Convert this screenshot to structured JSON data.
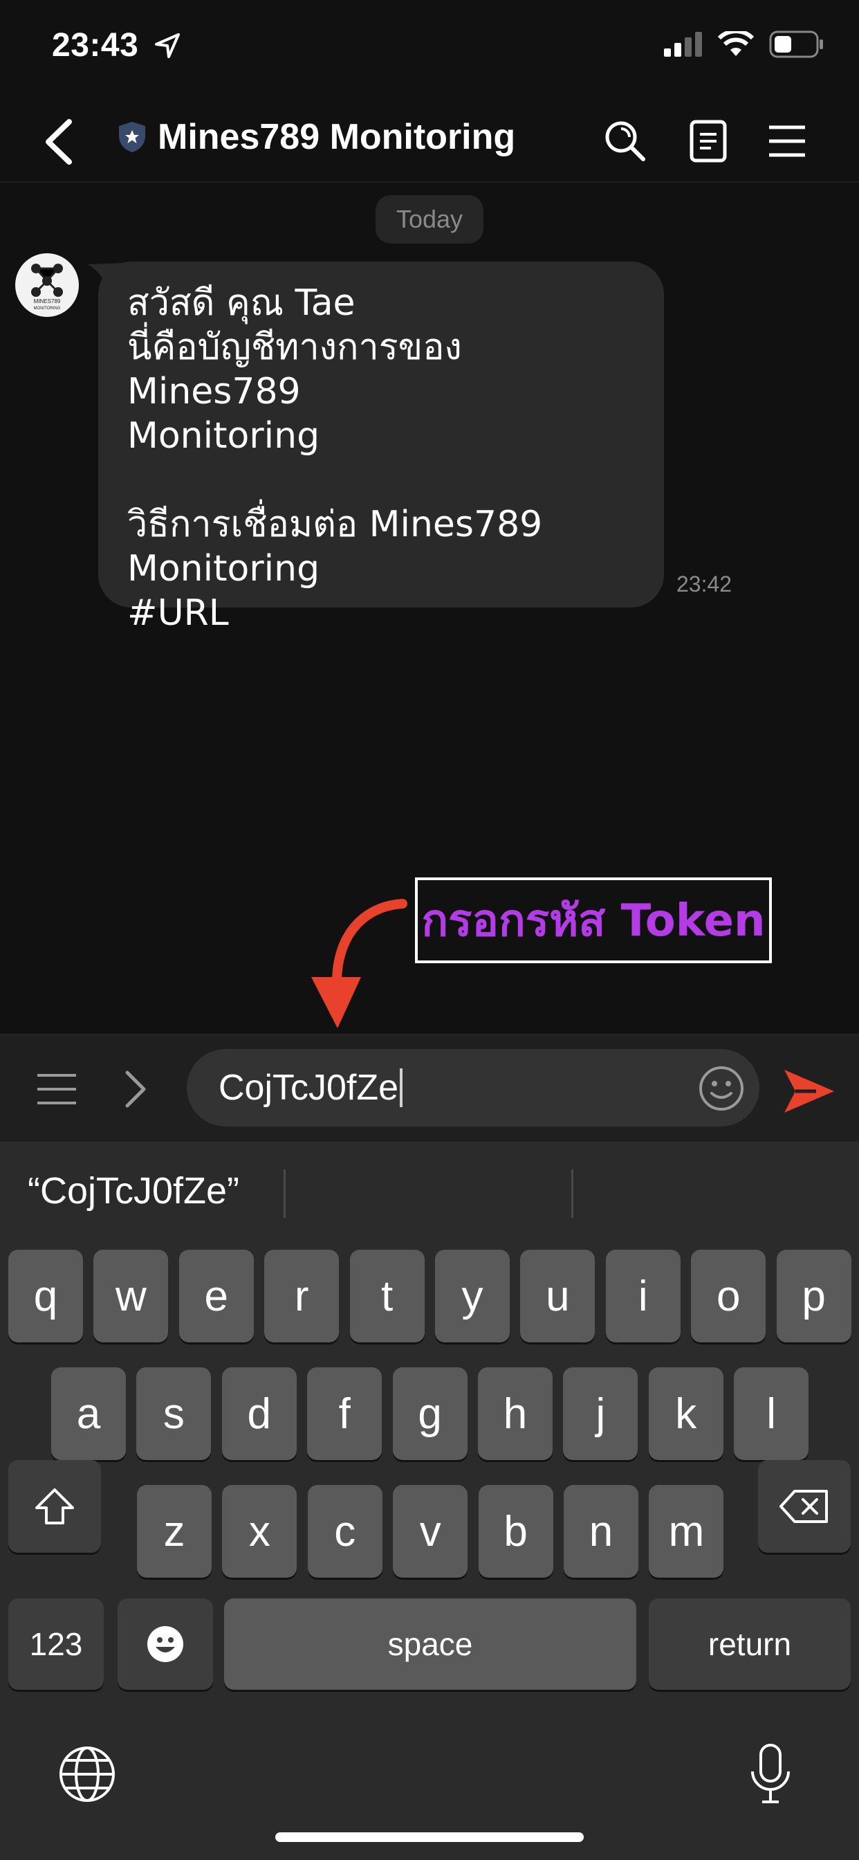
{
  "status": {
    "time": "23:43"
  },
  "header": {
    "title": "Mines789 Monitoring"
  },
  "chat": {
    "date_label": "Today",
    "avatar_text": "MINES789 MONITORING",
    "message": "สวัสดี คุณ Tae\nนี่คือบัญชีทางการของ Mines789\nMonitoring\n\nวิธีการเชื่อมต่อ Mines789\nMonitoring\n#URL",
    "message_time": "23:42"
  },
  "annotation": {
    "text": "กรอกรหัส Token",
    "color": "#b43ce6"
  },
  "input": {
    "value": "CojTcJ0fZe"
  },
  "keyboard": {
    "suggestion": "“CojTcJ0fZe”",
    "row1": [
      "q",
      "w",
      "e",
      "r",
      "t",
      "y",
      "u",
      "i",
      "o",
      "p"
    ],
    "row2": [
      "a",
      "s",
      "d",
      "f",
      "g",
      "h",
      "j",
      "k",
      "l"
    ],
    "row3": [
      "z",
      "x",
      "c",
      "v",
      "b",
      "n",
      "m"
    ],
    "numbers_label": "123",
    "space_label": "space",
    "return_label": "return"
  },
  "colors": {
    "accent": "#e8412c",
    "background": "#111111"
  }
}
